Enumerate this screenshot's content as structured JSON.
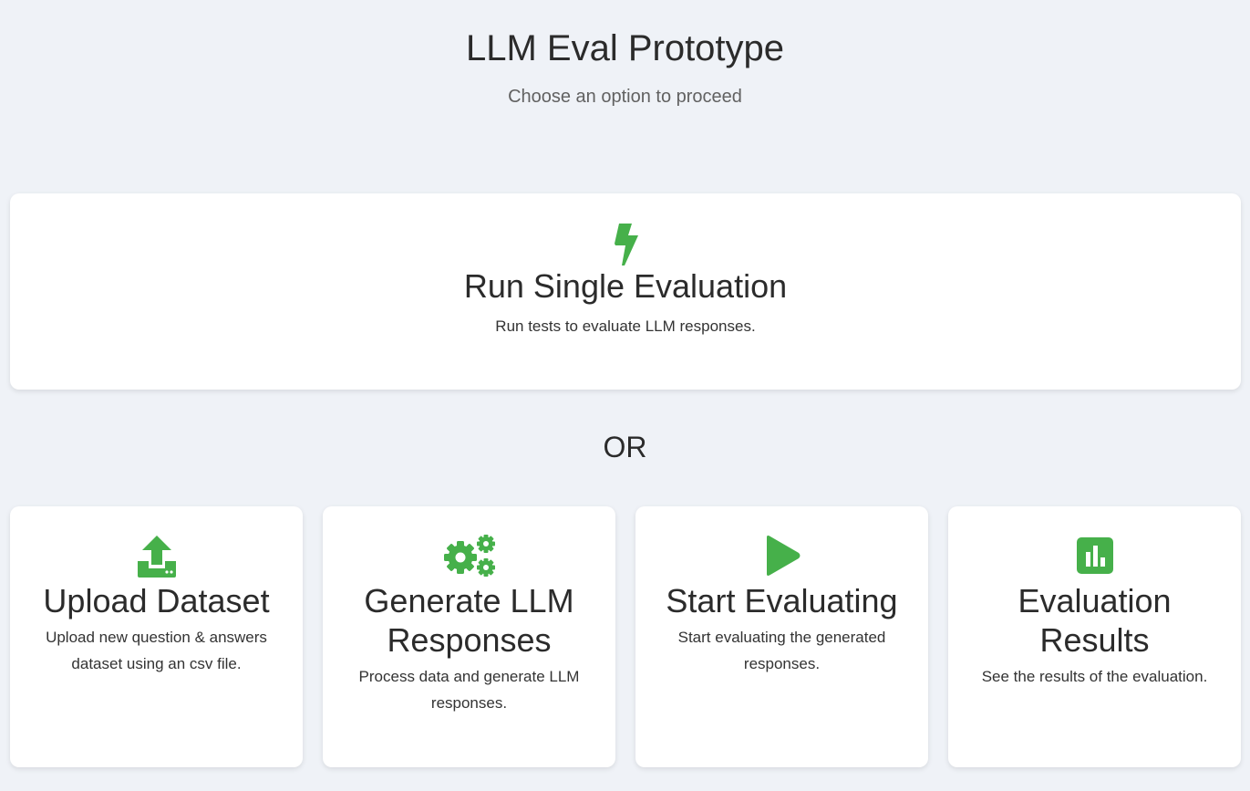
{
  "header": {
    "title": "LLM Eval Prototype",
    "subtitle": "Choose an option to proceed"
  },
  "accent_color": "#46b04a",
  "hero": {
    "icon": "bolt-icon",
    "title": "Run Single Evaluation",
    "description": "Run tests to evaluate LLM responses."
  },
  "divider_text": "OR",
  "cards": [
    {
      "icon": "upload-icon",
      "title": "Upload Dataset",
      "description": "Upload new question & answers dataset using an csv file."
    },
    {
      "icon": "gears-icon",
      "title": "Generate LLM Responses",
      "description": "Process data and generate LLM responses."
    },
    {
      "icon": "play-icon",
      "title": "Start Evaluating",
      "description": "Start evaluating the generated responses."
    },
    {
      "icon": "bar-chart-icon",
      "title": "Evaluation Results",
      "description": "See the results of the evaluation."
    }
  ]
}
